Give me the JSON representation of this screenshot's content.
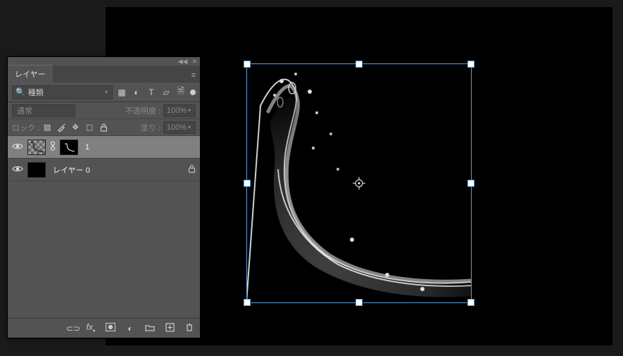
{
  "panel": {
    "title": "レイヤー",
    "search_label": "種類",
    "blend_mode": "通常",
    "opacity_label": "不透明度 :",
    "opacity_value": "100%",
    "lock_label": "ロック :",
    "fill_label": "塗り :",
    "fill_value": "100%",
    "filter_icons": [
      "image-icon",
      "adjustment-icon",
      "type-icon",
      "shape-icon",
      "smartobj-icon"
    ],
    "lock_icons": [
      "lock-pixels-icon",
      "lock-paint-icon",
      "lock-position-icon",
      "lock-artboard-icon",
      "lock-all-icon"
    ],
    "footer_icons": [
      "link-icon",
      "fx-icon",
      "mask-icon",
      "adjustment-layer-icon",
      "group-icon",
      "new-layer-icon",
      "delete-icon"
    ]
  },
  "layers": [
    {
      "name": "1",
      "visible": true,
      "selected": true,
      "has_mask": true,
      "linked_mask": true,
      "locked": false
    },
    {
      "name": "レイヤー 0",
      "visible": true,
      "selected": false,
      "has_mask": false,
      "linked_mask": false,
      "locked": true
    }
  ]
}
